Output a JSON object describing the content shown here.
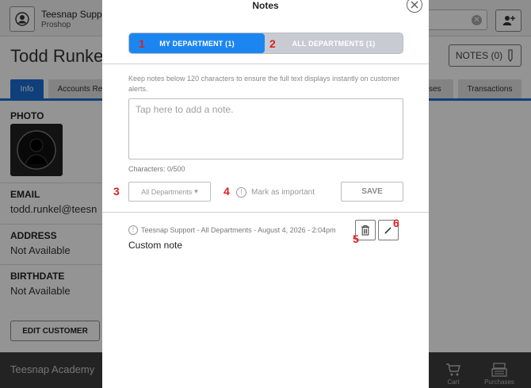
{
  "app": {
    "user_name": "Teesnap Support",
    "user_sub": "Proshop",
    "customer_name": "Todd Runkel",
    "notes_button": "NOTES (0)",
    "tabs": [
      {
        "label": "Info",
        "active": true
      },
      {
        "label": "Accounts Re",
        "active": false
      },
      {
        "label": "ases",
        "active": false
      },
      {
        "label": "Transactions",
        "active": false
      }
    ],
    "photo_label": "PHOTO",
    "email_label": "EMAIL",
    "email_value": "todd.runkel@teesn",
    "address_label": "ADDRESS",
    "address_value": "Not Available",
    "birthdate_label": "BIRTHDATE",
    "birthdate_value": "Not Available",
    "edit_button": "EDIT CUSTOMER",
    "academy_label": "Teesnap Academy",
    "cart_label": "Cart",
    "purchases_label": "Purchases"
  },
  "modal": {
    "title": "Notes",
    "tab_my_department": "MY DEPARTMENT (1)",
    "tab_all_departments": "ALL DEPARTMENTS (1)",
    "hint": "Keep notes below 120 characters to ensure the full text displays instantly on customer alerts.",
    "note_placeholder": "Tap here to add a note.",
    "char_count": "Characters: 0/500",
    "department_select": "All Departments",
    "mark_important": "Mark as important",
    "save_button": "SAVE",
    "note": {
      "meta": "Teesnap Support - All Departments  - August 4, 2026 - 2:04pm",
      "text": "Custom note"
    }
  },
  "callouts": [
    "1",
    "2",
    "3",
    "4",
    "5",
    "6"
  ],
  "colors": {
    "accent": "#1c86f0",
    "tab_accent": "#1c6fd3",
    "callout": "#e01e1e"
  }
}
